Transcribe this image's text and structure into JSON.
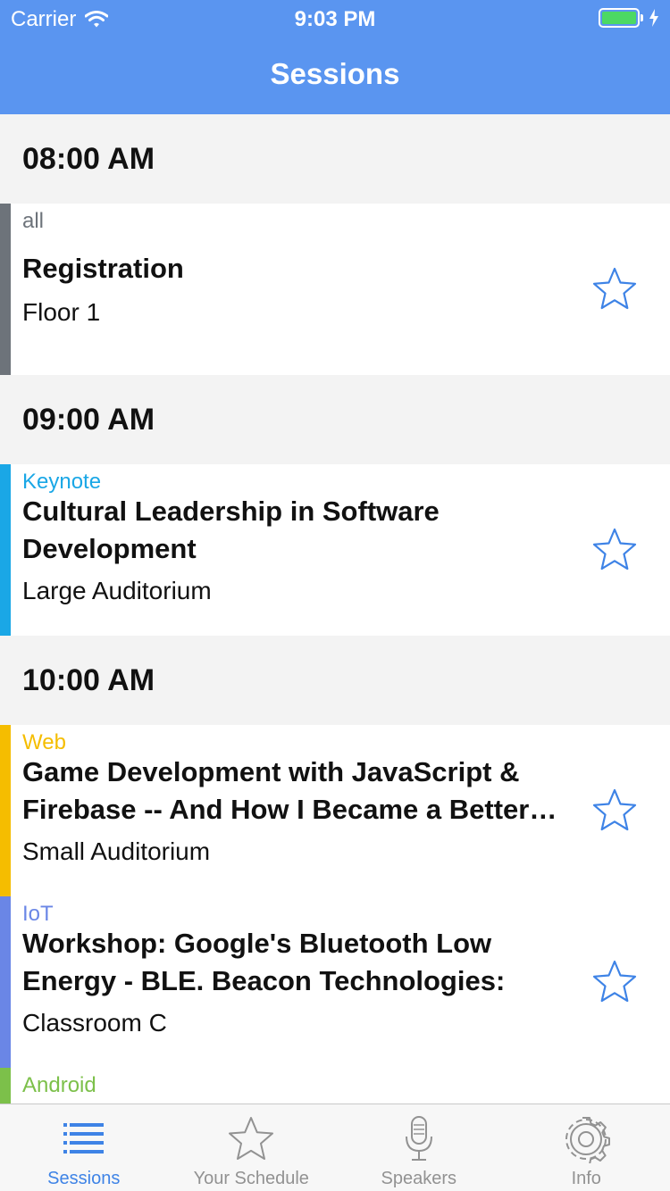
{
  "status": {
    "carrier": "Carrier",
    "time": "9:03 PM"
  },
  "nav": {
    "title": "Sessions"
  },
  "colors": {
    "header": "#5a95f0",
    "star": "#3e83e6",
    "track_all": "#6d737a",
    "track_keynote": "#1aa7e6",
    "track_web": "#f5bd00",
    "track_iot": "#6a86e6",
    "track_android": "#7cc04a"
  },
  "groups": [
    {
      "time": "08:00 AM",
      "sessions": [
        {
          "track": "all",
          "title": "Registration",
          "room": "Floor 1",
          "starred": false
        }
      ]
    },
    {
      "time": "09:00 AM",
      "sessions": [
        {
          "track": "Keynote",
          "title": "Cultural Leadership in Software Development",
          "room": "Large Auditorium",
          "starred": false
        }
      ]
    },
    {
      "time": "10:00 AM",
      "sessions": [
        {
          "track": "Web",
          "title": "Game Development with JavaScript & Firebase -- And How I Became a Better…",
          "room": "Small Auditorium",
          "starred": false
        },
        {
          "track": "IoT",
          "title": "Workshop: Google's Bluetooth Low Energy - BLE. Beacon Technologies: Ne…",
          "room": "Classroom C",
          "starred": false
        },
        {
          "track": "Android"
        }
      ]
    }
  ],
  "tabs": [
    {
      "label": "Sessions",
      "icon": "list-icon",
      "active": true
    },
    {
      "label": "Your Schedule",
      "icon": "star-icon",
      "active": false
    },
    {
      "label": "Speakers",
      "icon": "microphone-icon",
      "active": false
    },
    {
      "label": "Info",
      "icon": "gear-icon",
      "active": false
    }
  ]
}
